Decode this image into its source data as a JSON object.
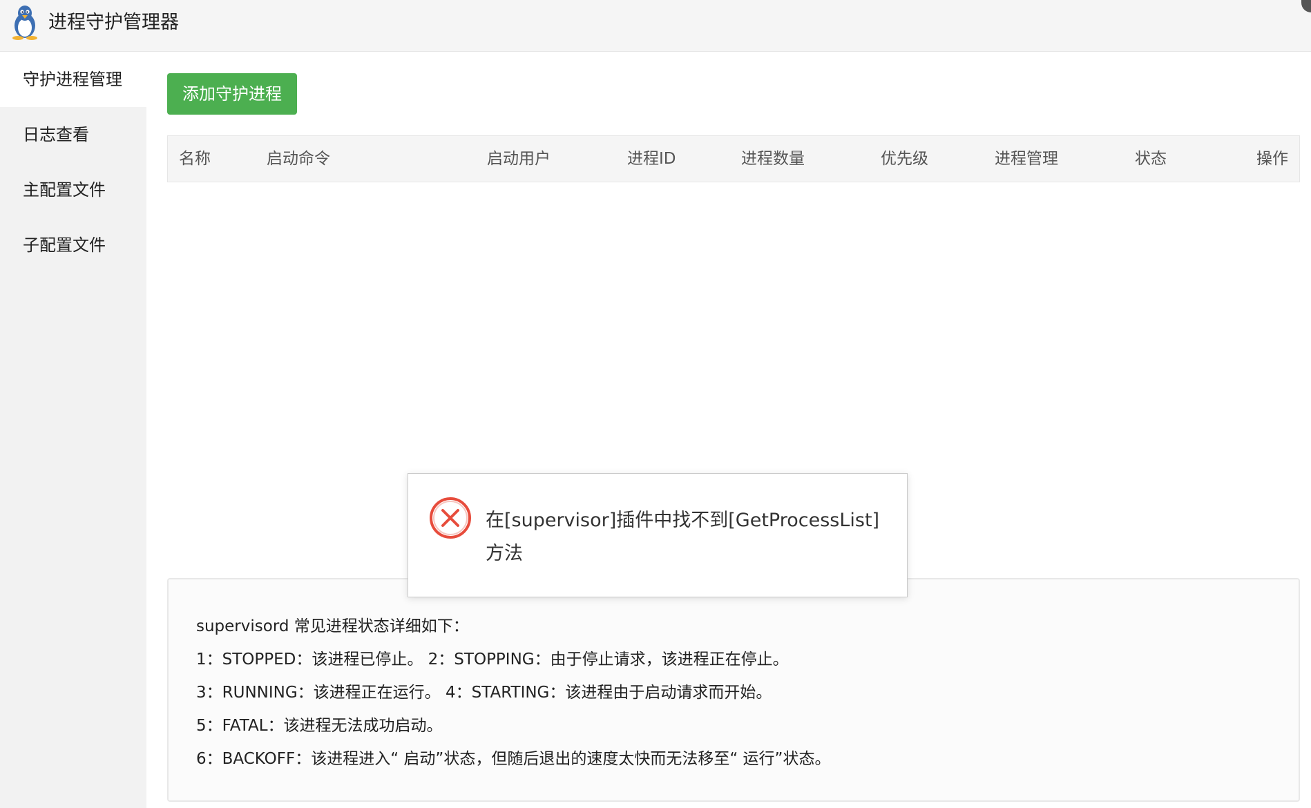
{
  "app": {
    "title": "进程守护管理器",
    "logo_icon": "penguin-icon"
  },
  "sidebar": {
    "items": [
      {
        "label": "守护进程管理",
        "active": true
      },
      {
        "label": "日志查看",
        "active": false
      },
      {
        "label": "主配置文件",
        "active": false
      },
      {
        "label": "子配置文件",
        "active": false
      }
    ]
  },
  "toolbar": {
    "add_label": "添加守护进程",
    "add_color": "#4caf50"
  },
  "table": {
    "columns": [
      "名称",
      "启动命令",
      "启动用户",
      "进程ID",
      "进程数量",
      "优先级",
      "进程管理",
      "状态",
      "操作"
    ],
    "rows": []
  },
  "toast": {
    "icon": "error-circle-x-icon",
    "message": "在[supervisor]插件中找不到[GetProcessList]方法",
    "color": "#e74c3c"
  },
  "info": {
    "title": "supervisord 常见进程状态详细如下：",
    "lines": [
      "1：STOPPED：该进程已停止。     2：STOPPING：由于停止请求，该进程正在停止。",
      "3：RUNNING：该进程正在运行。 4：STARTING：该进程由于启动请求而开始。",
      "5：FATAL：该进程无法成功启动。",
      "6：BACKOFF：该进程进入“ 启动”状态，但随后退出的速度太快而无法移至“ 运行”状态。"
    ]
  }
}
